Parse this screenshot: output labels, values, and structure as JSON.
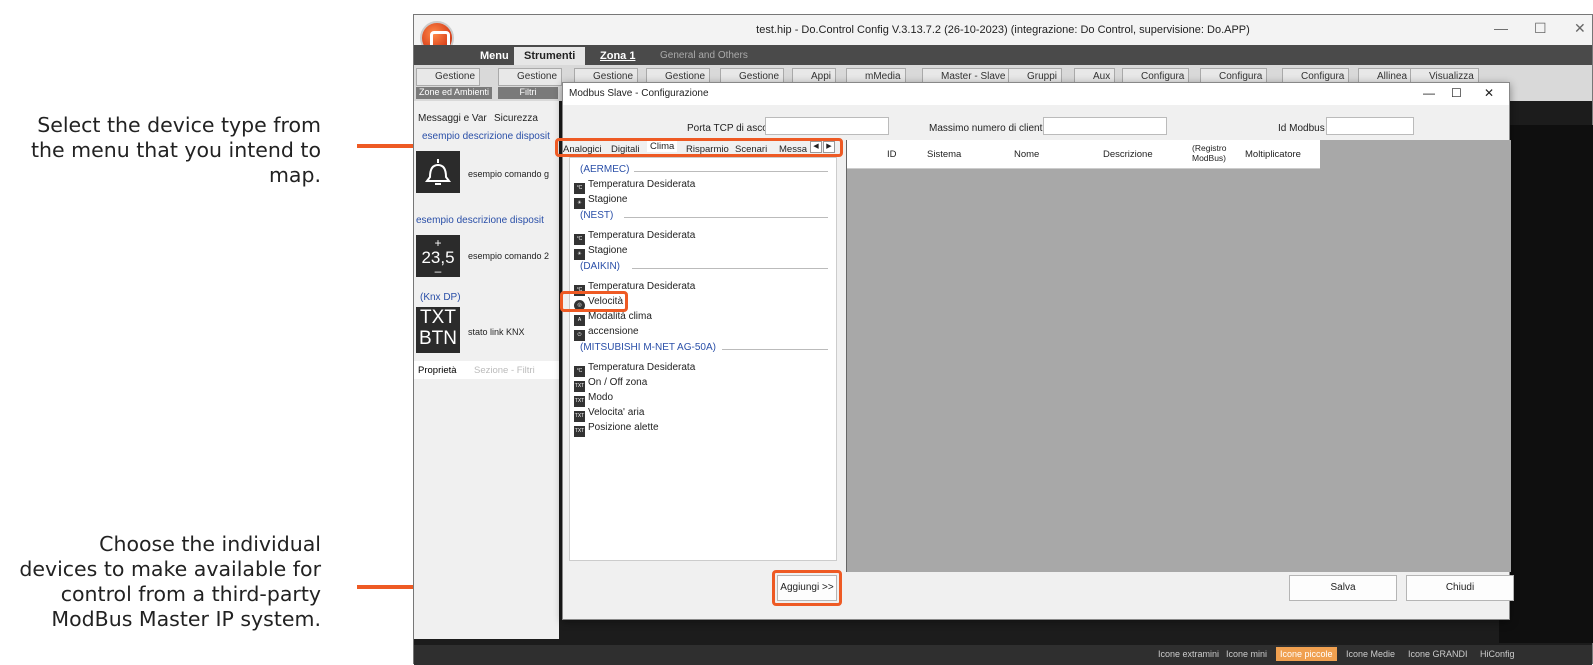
{
  "annotations": {
    "top": [
      "Select the device type from",
      "the menu that you intend to",
      "map."
    ],
    "bottom": [
      "Choose the individual",
      "devices to make available for",
      "control from a third-party",
      "ModBus Master IP system."
    ]
  },
  "window": {
    "title": "test.hip - Do.Control Config V.3.13.7.2 (26-10-2023) (integrazione: Do Control, supervisione: Do.APP)",
    "minimize": "—",
    "maximize": "☐",
    "close": "✕"
  },
  "menu": {
    "tabs": [
      "Menu",
      "Strumenti",
      "Zona 1",
      "General and Others"
    ]
  },
  "ribbon": {
    "buttons": [
      "Gestione",
      "Gestione",
      "Gestione",
      "Gestione",
      "Gestione",
      "Appi",
      "mMedia",
      "Master - Slave",
      "Gruppi",
      "Aux",
      "Configura",
      "Configura",
      "Configura",
      "Allinea",
      "Visualizza"
    ],
    "subs": [
      "Zone ed Ambienti",
      "Filtri"
    ]
  },
  "leftpanel": {
    "tabs": [
      "Messaggi e Var",
      "Sicurezza"
    ],
    "desc1": "esempio descrizione disposit",
    "cmd1": "esempio comando g",
    "desc2": "esempio descrizione disposit",
    "icon2": "23,5",
    "cmd2": "esempio comando 2",
    "knx": "(Knx DP)",
    "icon3_top": "TXT",
    "icon3_bot": "BTN",
    "knx_text": "stato link KNX",
    "prop_tabs": [
      "Proprietà",
      "Sezione - Filtri"
    ]
  },
  "dialog": {
    "title": "Modbus Slave - Configurazione",
    "min": "—",
    "max": "☐",
    "close": "✕",
    "porta_label": "Porta TCP di ascolto:",
    "max_label": "Massimo numero di client:",
    "id_label": "Id Modbus",
    "tabs": [
      "Analogici",
      "Digitali",
      "Clima",
      "Risparmio",
      "Scenari",
      "Messa"
    ],
    "groups": [
      {
        "name": "(AERMEC)",
        "items": [
          "Temperatura Desiderata",
          "Stagione"
        ]
      },
      {
        "name": "(NEST)",
        "items": [
          "Temperatura Desiderata",
          "Stagione"
        ]
      },
      {
        "name": "(DAIKIN)",
        "items": [
          "Temperatura Desiderata",
          "Velocità",
          "Modalità clima",
          "accensione"
        ]
      },
      {
        "name": "(MITSUBISHI M-NET AG-50A)",
        "items": [
          "Temperatura Desiderata",
          "On / Off zona",
          "Modo",
          "Velocita' aria",
          "Posizione alette"
        ]
      }
    ],
    "columns": [
      "ID",
      "Sistema",
      "Nome",
      "Descrizione",
      "(Registro ModBus)",
      "Moltiplicatore"
    ],
    "add_button": "Aggiungi >>",
    "save_button": "Salva",
    "close_button": "Chiudi"
  },
  "statusbar": [
    "Icone extramini",
    "Icone mini",
    "Icone piccole",
    "Icone Medie",
    "Icone GRANDI",
    "HiConfig"
  ],
  "colors": {
    "accent": "#ee5a24",
    "link": "#2a4fa8"
  }
}
